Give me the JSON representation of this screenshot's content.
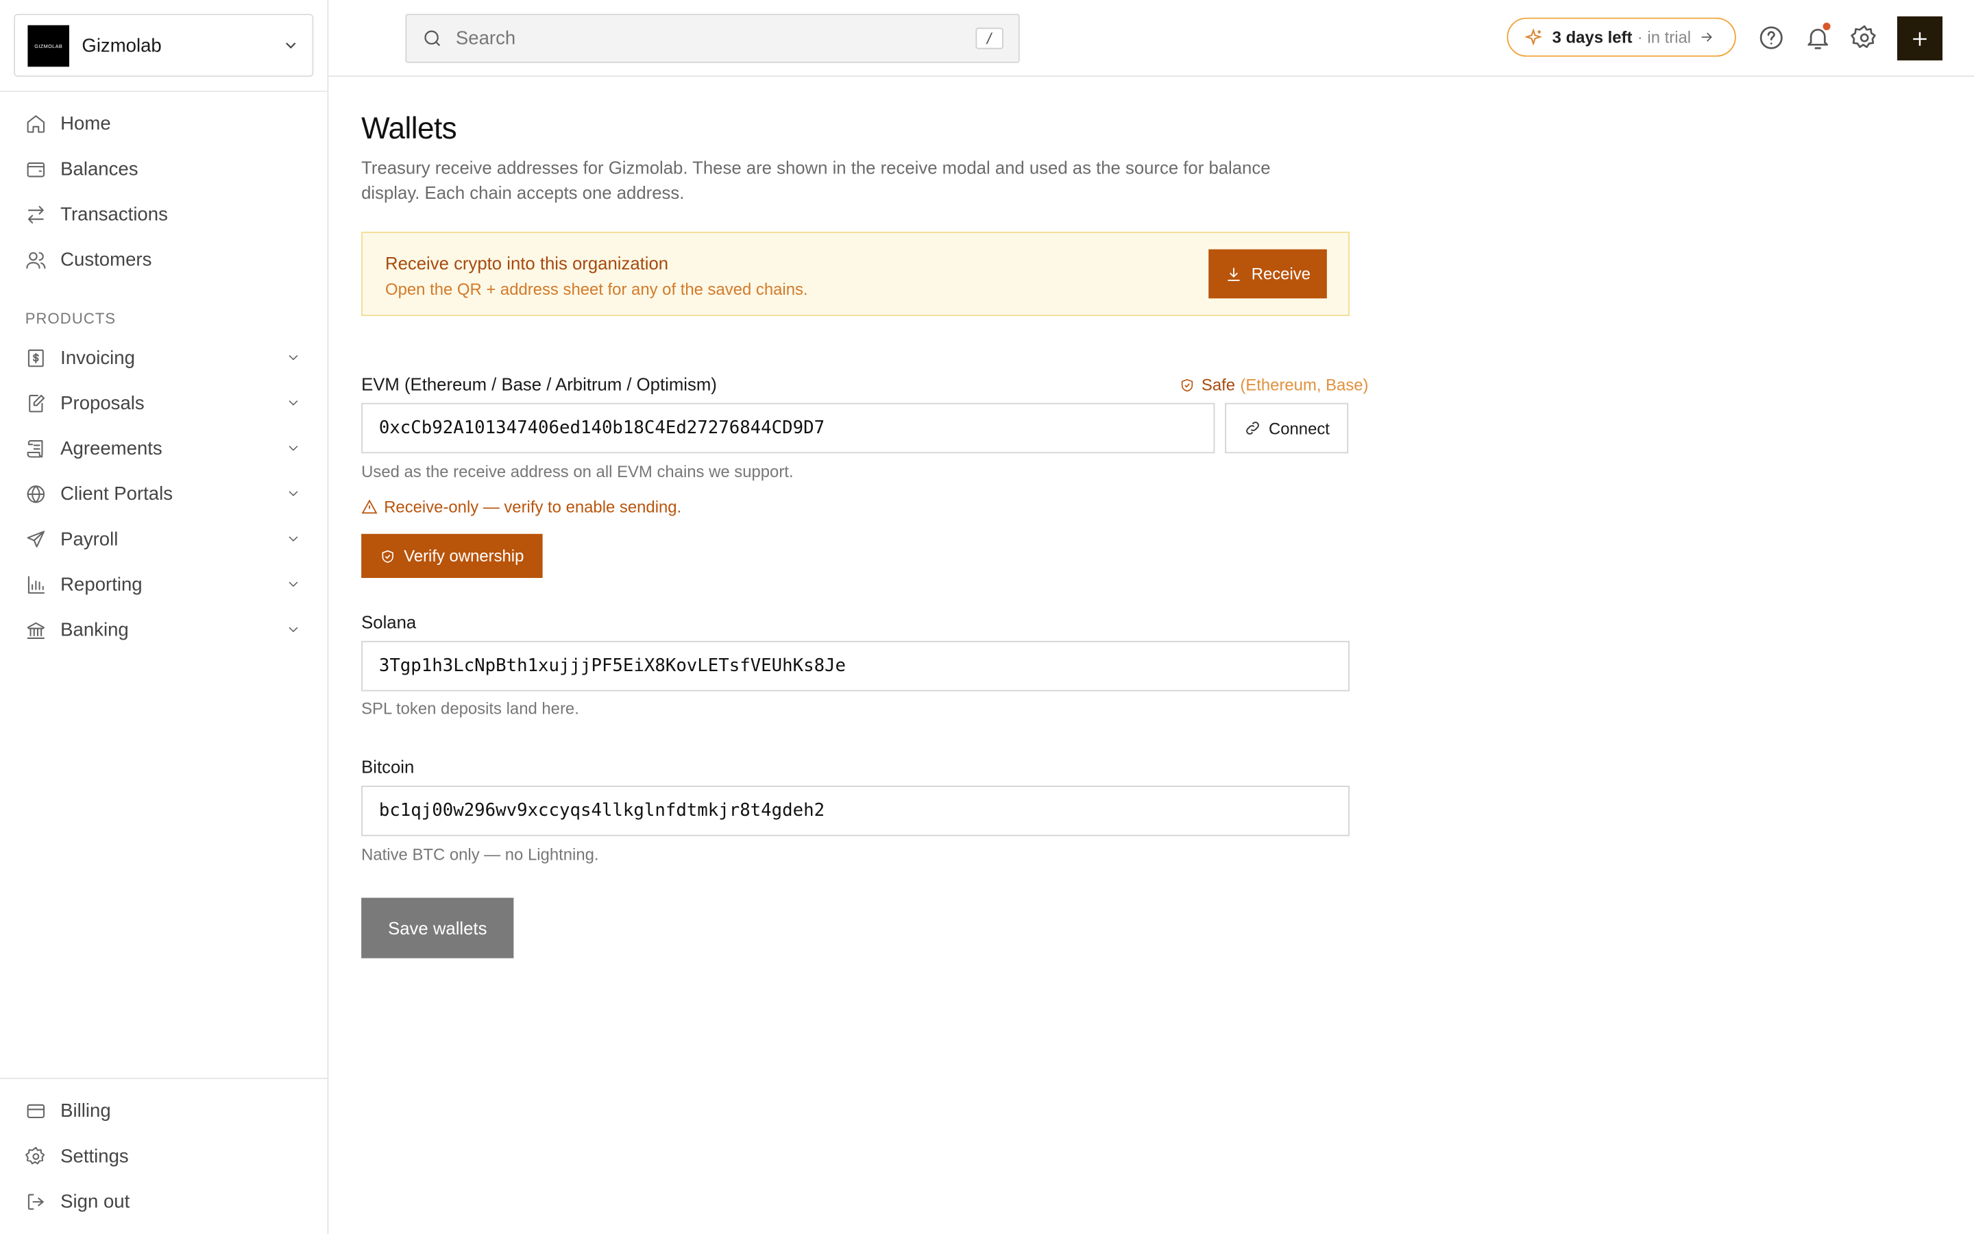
{
  "org": {
    "name": "Gizmolab",
    "logo_text": "GIZMOLAB"
  },
  "sidebar": {
    "main_items": [
      {
        "label": "Home",
        "icon": "home-icon"
      },
      {
        "label": "Balances",
        "icon": "wallet-icon"
      },
      {
        "label": "Transactions",
        "icon": "arrows-icon"
      },
      {
        "label": "Customers",
        "icon": "users-icon"
      }
    ],
    "section_label": "PRODUCTS",
    "product_items": [
      {
        "label": "Invoicing",
        "icon": "invoice-icon"
      },
      {
        "label": "Proposals",
        "icon": "proposal-icon"
      },
      {
        "label": "Agreements",
        "icon": "scroll-icon"
      },
      {
        "label": "Client Portals",
        "icon": "globe-icon"
      },
      {
        "label": "Payroll",
        "icon": "send-icon"
      },
      {
        "label": "Reporting",
        "icon": "chart-icon"
      },
      {
        "label": "Banking",
        "icon": "bank-icon"
      }
    ],
    "bottom_items": [
      {
        "label": "Billing",
        "icon": "credit-card-icon"
      },
      {
        "label": "Settings",
        "icon": "gear-icon"
      },
      {
        "label": "Sign out",
        "icon": "sign-out-icon"
      }
    ]
  },
  "topbar": {
    "search_placeholder": "Search",
    "search_shortcut": "/",
    "trial_bold": "3 days left",
    "trial_dim": "· in trial"
  },
  "page": {
    "title": "Wallets",
    "description": "Treasury receive addresses for Gizmolab. These are shown in the receive modal and used as the source for balance display. Each chain accepts one address.",
    "banner": {
      "title": "Receive crypto into this organization",
      "subtitle": "Open the QR + address sheet for any of the saved chains.",
      "button": "Receive"
    },
    "evm": {
      "label": "EVM (Ethereum / Base / Arbitrum / Optimism)",
      "safe_label": "Safe",
      "safe_chains": "(Ethereum, Base)",
      "value": "0xcCb92A101347406ed140b18C4Ed27276844CD9D7",
      "connect": "Connect",
      "hint": "Used as the receive address on all EVM chains we support.",
      "warning": "Receive-only — verify to enable sending.",
      "verify_button": "Verify ownership"
    },
    "solana": {
      "label": "Solana",
      "value": "3Tgp1h3LcNpBth1xujjjPF5EiX8KovLETsfVEUhKs8Je",
      "hint": "SPL token deposits land here."
    },
    "bitcoin": {
      "label": "Bitcoin",
      "value": "bc1qj00w296wv9xccyqs4llkglnfdtmkjr8t4gdeh2",
      "hint": "Native BTC only — no Lightning."
    },
    "save_button": "Save wallets"
  },
  "colors": {
    "accent": "#b9540b",
    "banner_bg": "#fef9e7",
    "primary_dark": "#231a08",
    "trial_border": "#f0a33a"
  }
}
